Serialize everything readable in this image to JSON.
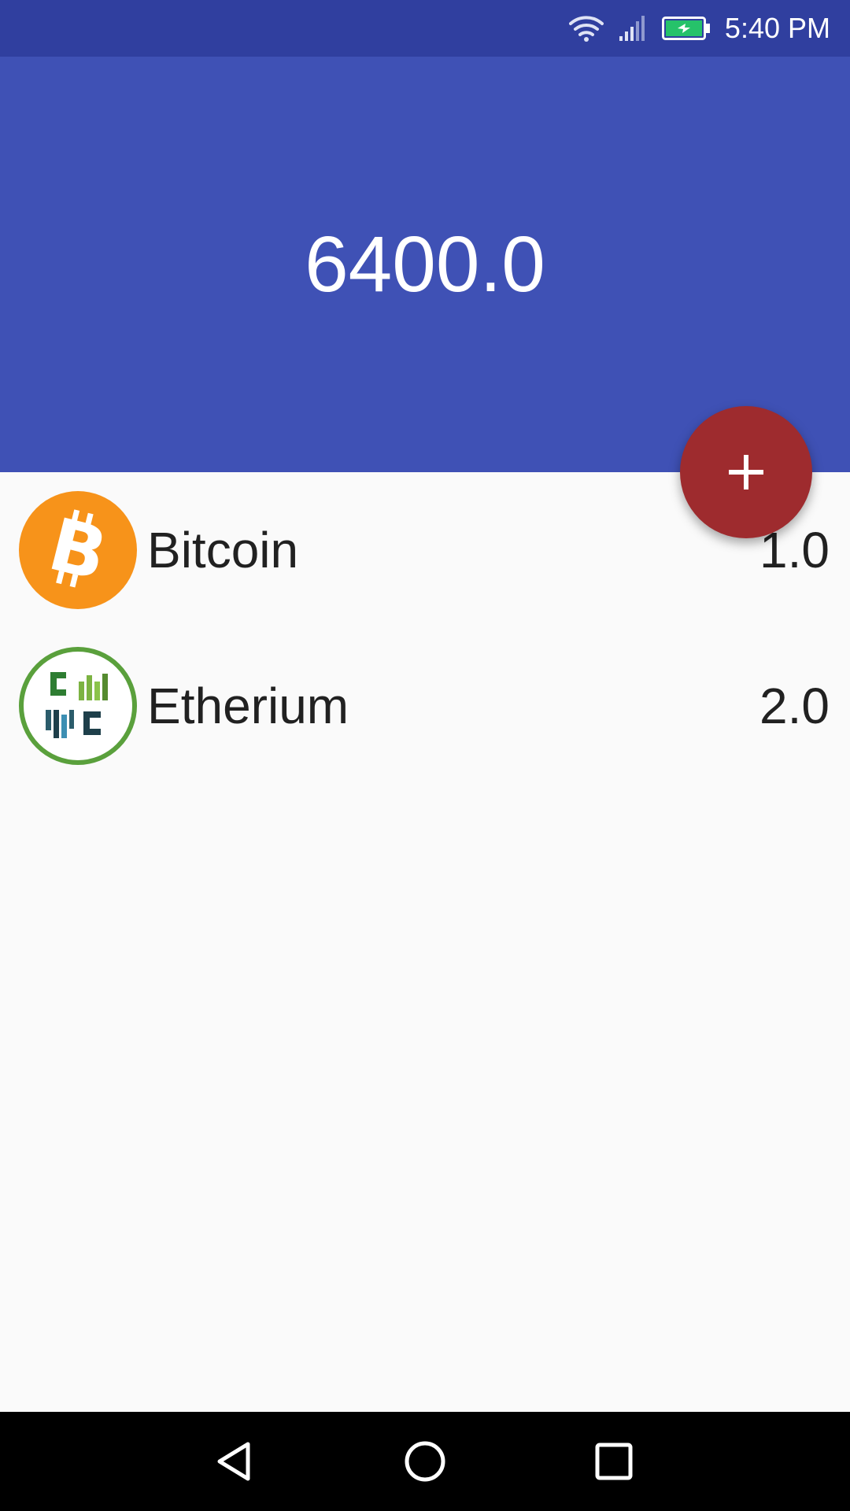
{
  "status_bar": {
    "time": "5:40 PM",
    "icons": [
      "wifi-icon",
      "signal-icon",
      "battery-charging-icon"
    ]
  },
  "header": {
    "total_value": "6400.0",
    "background_color": "#3f51b5"
  },
  "fab": {
    "icon": "plus-icon",
    "color": "#9e2b2e"
  },
  "coins": [
    {
      "name": "Bitcoin",
      "amount": "1.0",
      "icon": "bitcoin-icon"
    },
    {
      "name": "Etherium",
      "amount": "2.0",
      "icon": "coin-logo-icon"
    }
  ],
  "navigation": {
    "buttons": [
      "back-icon",
      "home-icon",
      "recents-icon"
    ]
  }
}
